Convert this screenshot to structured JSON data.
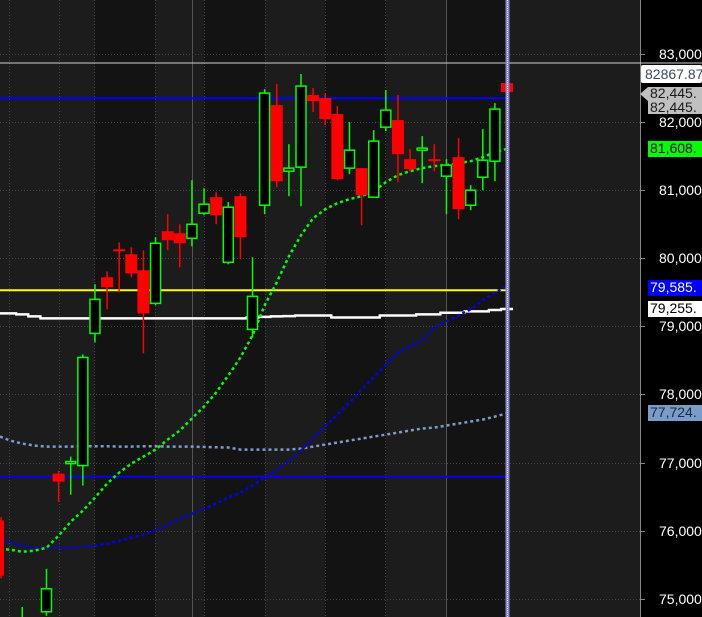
{
  "chart_data": {
    "type": "candlestick",
    "title": "",
    "xlabel": "",
    "ylabel": "",
    "ylim": [
      74750,
      83120
    ],
    "grid": true,
    "y_ticks": [
      "83,000",
      "82,000",
      "81,000",
      "80,000",
      "79,000",
      "78,000",
      "77,000",
      "76,000",
      "75,000"
    ],
    "y_tick_values": [
      83000,
      82000,
      81000,
      80000,
      79000,
      78000,
      77000,
      76000,
      75000
    ],
    "colors": {
      "up": "#00ff00",
      "down": "#ff0000",
      "ma_fast": "#00ff00",
      "ma_mid": "#0000ff",
      "ma_slow": "#7b9cc9",
      "step_line": "#ffffff",
      "level_yellow": "#ffff00",
      "level_blue": "#0000ff",
      "crosshair": "#b0b0ff"
    },
    "candles": [
      {
        "o": 76150,
        "h": 76200,
        "l": 75300,
        "c": 75340
      },
      {
        "o": 74300,
        "h": 74400,
        "l": 74100,
        "c": 74200
      },
      {
        "o": 74300,
        "h": 74880,
        "l": 74200,
        "c": 74600
      },
      {
        "o": 74300,
        "h": 74400,
        "l": 74100,
        "c": 74200
      },
      {
        "o": 74809,
        "h": 75441,
        "l": 74750,
        "c": 75147
      },
      {
        "o": 76838,
        "h": 76882,
        "l": 76426,
        "c": 76721
      },
      {
        "o": 76985,
        "h": 77088,
        "l": 76529,
        "c": 77015
      },
      {
        "o": 76956,
        "h": 78588,
        "l": 76662,
        "c": 78544
      },
      {
        "o": 78897,
        "h": 79618,
        "l": 78765,
        "c": 79397
      },
      {
        "o": 79721,
        "h": 79809,
        "l": 79250,
        "c": 79574
      },
      {
        "o": 80132,
        "h": 80235,
        "l": 79500,
        "c": 80103
      },
      {
        "o": 80059,
        "h": 80162,
        "l": 79721,
        "c": 79779
      },
      {
        "o": 79824,
        "h": 80118,
        "l": 78603,
        "c": 79191
      },
      {
        "o": 79338,
        "h": 80309,
        "l": 79309,
        "c": 80221
      },
      {
        "o": 80397,
        "h": 80647,
        "l": 80118,
        "c": 80265
      },
      {
        "o": 80368,
        "h": 80500,
        "l": 79868,
        "c": 80221
      },
      {
        "o": 80294,
        "h": 81147,
        "l": 80176,
        "c": 80500
      },
      {
        "o": 80662,
        "h": 81029,
        "l": 80632,
        "c": 80794
      },
      {
        "o": 80897,
        "h": 80971,
        "l": 80500,
        "c": 80632
      },
      {
        "o": 79941,
        "h": 80824,
        "l": 79912,
        "c": 80750
      },
      {
        "o": 80912,
        "h": 80956,
        "l": 79985,
        "c": 80309
      },
      {
        "o": 78956,
        "h": 80015,
        "l": 78838,
        "c": 79441
      },
      {
        "o": 80779,
        "h": 82485,
        "l": 80647,
        "c": 82426
      },
      {
        "o": 82250,
        "h": 82559,
        "l": 81044,
        "c": 81132
      },
      {
        "o": 81279,
        "h": 81676,
        "l": 80912,
        "c": 81324
      },
      {
        "o": 81338,
        "h": 82706,
        "l": 80765,
        "c": 82529
      },
      {
        "o": 82397,
        "h": 82500,
        "l": 82147,
        "c": 82309
      },
      {
        "o": 82353,
        "h": 82426,
        "l": 81956,
        "c": 82044
      },
      {
        "o": 82118,
        "h": 82235,
        "l": 81147,
        "c": 81162
      },
      {
        "o": 81324,
        "h": 82000,
        "l": 81235,
        "c": 81588
      },
      {
        "o": 81324,
        "h": 81324,
        "l": 80485,
        "c": 80926
      },
      {
        "o": 80897,
        "h": 81882,
        "l": 80897,
        "c": 81721
      },
      {
        "o": 81926,
        "h": 82471,
        "l": 81868,
        "c": 82176
      },
      {
        "o": 82029,
        "h": 82397,
        "l": 81118,
        "c": 81529
      },
      {
        "o": 81456,
        "h": 81603,
        "l": 81279,
        "c": 81309
      },
      {
        "o": 81588,
        "h": 81794,
        "l": 81103,
        "c": 81618
      },
      {
        "o": 81456,
        "h": 81676,
        "l": 81279,
        "c": 81426
      },
      {
        "o": 81206,
        "h": 81456,
        "l": 80647,
        "c": 81368
      },
      {
        "o": 81485,
        "h": 81765,
        "l": 80574,
        "c": 80721
      },
      {
        "o": 80779,
        "h": 81074,
        "l": 80706,
        "c": 81000
      },
      {
        "o": 81191,
        "h": 81897,
        "l": 81000,
        "c": 81441
      },
      {
        "o": 81426,
        "h": 82279,
        "l": 81132,
        "c": 82191
      },
      {
        "o": 82574,
        "h": 82662,
        "l": 82265,
        "c": 82441
      }
    ],
    "ma_fast": [
      75735,
      75721,
      75691,
      75706,
      75750,
      75926,
      76132,
      76294,
      76485,
      76691,
      76853,
      76985,
      77088,
      77191,
      77338,
      77471,
      77647,
      77824,
      78029,
      78279,
      78544,
      78868,
      79309,
      79647,
      80029,
      80338,
      80588,
      80721,
      80809,
      80868,
      80912,
      80985,
      81118,
      81221,
      81279,
      81324,
      81353,
      81368,
      81397,
      81426,
      81485,
      81559,
      81608
    ],
    "ma_mid": [
      75882,
      75824,
      75779,
      75750,
      75750,
      75750,
      75750,
      75765,
      75779,
      75809,
      75853,
      75897,
      75941,
      76000,
      76088,
      76176,
      76250,
      76324,
      76397,
      76485,
      76559,
      76662,
      76779,
      76897,
      77015,
      77176,
      77353,
      77529,
      77706,
      77882,
      78074,
      78250,
      78441,
      78618,
      78706,
      78794,
      78985,
      79074,
      79162,
      79250,
      79382,
      79500,
      79585
    ],
    "ma_slow": [
      77382,
      77324,
      77279,
      77250,
      77235,
      77235,
      77235,
      77240,
      77240,
      77240,
      77235,
      77235,
      77240,
      77240,
      77235,
      77235,
      77235,
      77230,
      77225,
      77221,
      77191,
      77191,
      77191,
      77191,
      77191,
      77206,
      77235,
      77265,
      77294,
      77324,
      77353,
      77382,
      77412,
      77441,
      77471,
      77500,
      77515,
      77544,
      77574,
      77603,
      77632,
      77676,
      77724
    ],
    "step_line": [
      79191,
      79191,
      79176,
      79147,
      79118,
      79118,
      79118,
      79118,
      79118,
      79118,
      79118,
      79118,
      79118,
      79118,
      79118,
      79118,
      79118,
      79118,
      79118,
      79118,
      79118,
      79130,
      79140,
      79147,
      79150,
      79160,
      79160,
      79160,
      79130,
      79130,
      79130,
      79130,
      79160,
      79160,
      79160,
      79176,
      79176,
      79200,
      79200,
      79220,
      79220,
      79240,
      79255
    ],
    "levels": {
      "blue_upper": 82350,
      "yellow": 79530,
      "blue_lower": 76794,
      "last_price": 82867.87
    },
    "price_tags": {
      "last": "82867.87",
      "level_1": "82,445.",
      "level_2": "82,445.",
      "ma_fast": "81,608.",
      "ma_mid": "79,585.",
      "step_line": "79,255.",
      "ma_slow": "77,724."
    }
  }
}
